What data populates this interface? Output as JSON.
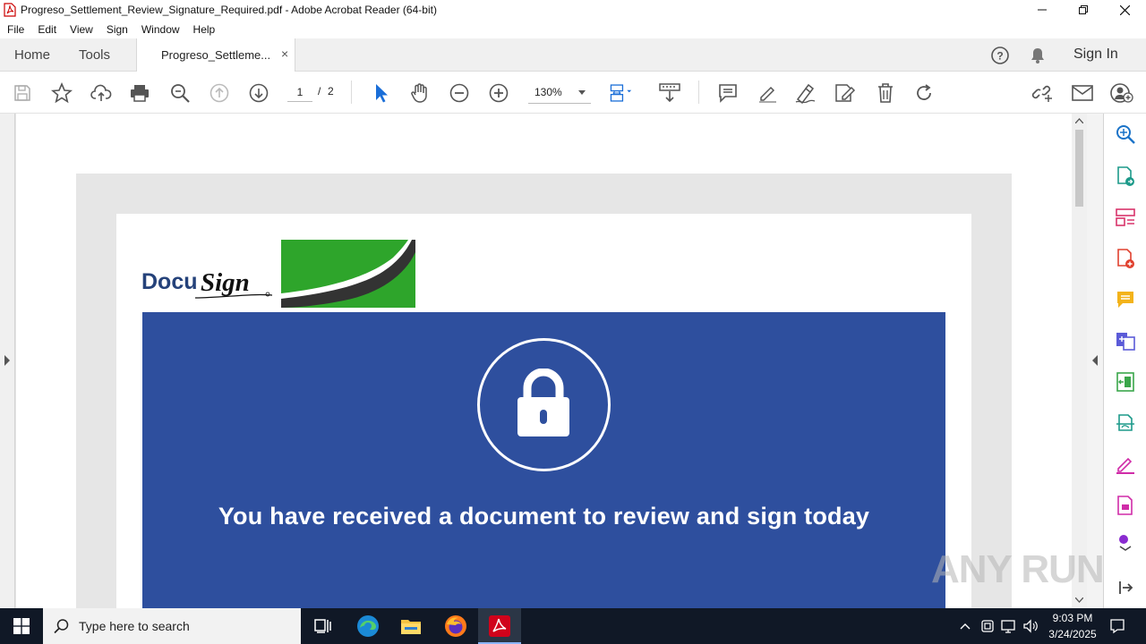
{
  "window": {
    "title": "Progreso_Settlement_Review_Signature_Required.pdf - Adobe Acrobat Reader (64-bit)"
  },
  "menu": [
    "File",
    "Edit",
    "View",
    "Sign",
    "Window",
    "Help"
  ],
  "tabs": {
    "home": "Home",
    "tools": "Tools",
    "document": "Progreso_Settleme...",
    "close": "×",
    "sign_in": "Sign In"
  },
  "toolbar": {
    "page_current": "1",
    "page_separator": "/",
    "page_total": "2",
    "zoom": "130%"
  },
  "document": {
    "logo_text": "DocuSign",
    "headline": "You have received a document to review and sign today"
  },
  "watermark": "ANY RUN",
  "taskbar": {
    "search_placeholder": "Type here to search",
    "time": "9:03 PM",
    "date": "3/24/2025"
  },
  "colors": {
    "banner": "#2e4f9e",
    "logo_green": "#2ea52b",
    "acrobat_red": "#d0021b",
    "taskbar": "#101826"
  },
  "icons": {
    "toolbar": [
      "save-icon",
      "bookmark-star-icon",
      "upload-icon",
      "print-icon",
      "zoom-search-icon",
      "page-up-icon",
      "page-down-icon",
      "select-arrow-icon",
      "hand-icon",
      "zoom-out-icon",
      "zoom-in-icon",
      "fit-page-icon",
      "scroll-mode-icon",
      "comment-icon",
      "highlight-icon",
      "draw-icon",
      "stamp-icon",
      "delete-icon",
      "rotate-icon",
      "link-icon",
      "email-icon",
      "add-user-icon"
    ],
    "right_panel": [
      "search-panel-icon",
      "export-pdf-icon",
      "organize-pages-icon",
      "create-pdf-icon",
      "comment-panel-icon",
      "combine-files-icon",
      "edit-pdf-icon",
      "scan-icon",
      "fill-sign-icon",
      "protect-icon",
      "more-tools-icon",
      "expand-icon"
    ]
  }
}
